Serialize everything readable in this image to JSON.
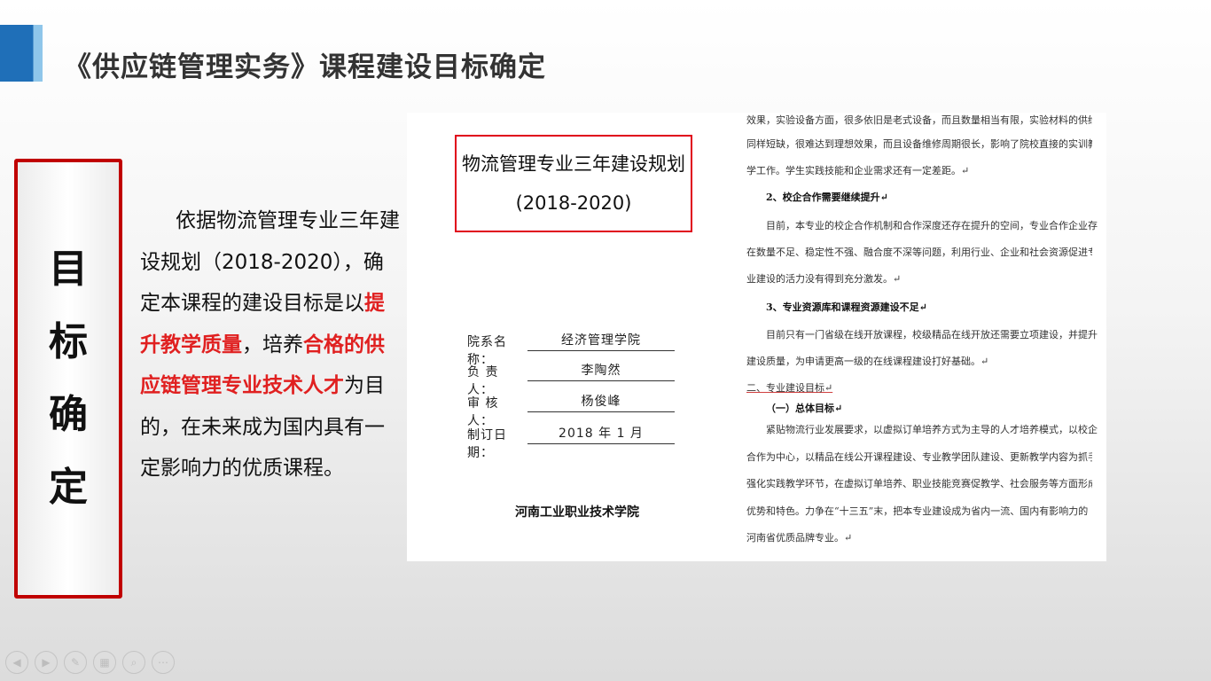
{
  "slide": {
    "title": "《供应链管理实务》课程建设目标确定",
    "vertical_label": [
      "目",
      "标",
      "确",
      "定"
    ]
  },
  "description": {
    "part1": "依据物流管理专业三年建设规划（2018-2020），确定本课程的建设目标是以",
    "highlight1": "提升教学质量",
    "part2": "，培养",
    "highlight2": "合格的供应链管理专业技术人才",
    "part3": "为目的，在未来成为国内具有一定影响力的优质课程。",
    "highlight_color": "#e02020"
  },
  "document": {
    "title": "物流管理专业三年建设规划",
    "years": "(2018-2020)",
    "form": [
      {
        "label": "院系名称：",
        "value": "经济管理学院"
      },
      {
        "label": "负 责 人：",
        "value": "李陶然"
      },
      {
        "label": "审 核 人：",
        "value": "杨俊峰"
      },
      {
        "label": "制订日期：",
        "value": "2018 年 1 月"
      }
    ],
    "school": "河南工业职业技术学院",
    "body_lines": [
      {
        "text": "效果，实验设备方面，很多依旧是老式设备，而且数量相当有限，实验材料的供给",
        "style": ""
      },
      {
        "text": "同样短缺，很难达到理想效果，而且设备维修周期很长，影响了院校直接的实训教",
        "style": ""
      },
      {
        "text": "学工作。学生实践技能和企业需求还有一定差距。↵",
        "style": ""
      },
      {
        "text": "2、校企合作需要继续提升↵",
        "style": "bold"
      },
      {
        "text": "目前，本专业的校企合作机制和合作深度还存在提升的空间，专业合作企业存",
        "style": ""
      },
      {
        "text": "在数量不足、稳定性不强、融合度不深等问题，利用行业、企业和社会资源促进专",
        "style": ""
      },
      {
        "text": "业建设的活力没有得到充分激发。↵",
        "style": ""
      },
      {
        "text": "3、专业资源库和课程资源建设不足↵",
        "style": "bold"
      },
      {
        "text": "目前只有一门省级在线开放课程，校级精品在线开放还需要立项建设，并提升",
        "style": ""
      },
      {
        "text": "建设质量，为申请更高一级的在线课程建设打好基础。↵",
        "style": ""
      },
      {
        "text": "二、专业建设目标↵",
        "style": "under"
      },
      {
        "text": "（一）总体目标↵",
        "style": "bold"
      },
      {
        "text": "紧贴物流行业发展要求，以虚拟订单培养方式为主导的人才培养模式，以校企",
        "style": ""
      },
      {
        "text": "合作为中心，以精品在线公开课程建设、专业教学团队建设、更新教学内容为抓手，",
        "style": ""
      },
      {
        "text": "强化实践教学环节，在虚拟订单培养、职业技能竞赛促教学、社会服务等方面形成",
        "style": ""
      },
      {
        "text": "优势和特色。力争在“十三五”末，把本专业建设成为省内一流、国内有影响力的",
        "style": ""
      },
      {
        "text": "河南省优质品牌专业。↵",
        "style": ""
      }
    ]
  },
  "toolbar": [
    {
      "name": "prev-slide-button",
      "icon": "left-arrow-icon",
      "glyph": "◀"
    },
    {
      "name": "next-slide-button",
      "icon": "right-arrow-icon",
      "glyph": "▶"
    },
    {
      "name": "pen-tool-button",
      "icon": "pen-icon",
      "glyph": "✎"
    },
    {
      "name": "slide-overview-button",
      "icon": "grid-icon",
      "glyph": "▦"
    },
    {
      "name": "zoom-button",
      "icon": "magnifier-icon",
      "glyph": "⌕"
    },
    {
      "name": "more-options-button",
      "icon": "more-icon",
      "glyph": "⋯"
    }
  ]
}
